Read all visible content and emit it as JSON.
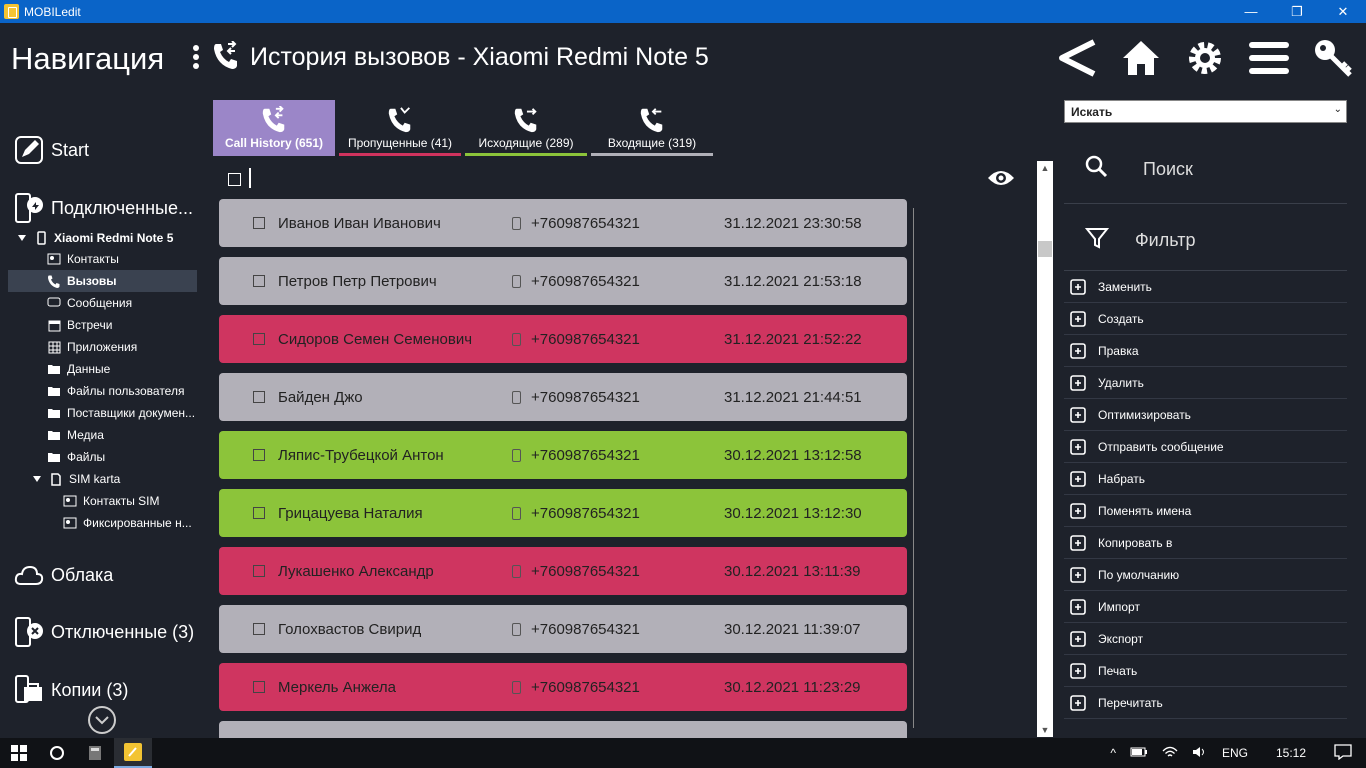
{
  "window": {
    "title": "MOBILedit",
    "min": "—",
    "max": "❐",
    "close": "✕"
  },
  "header": {
    "nav_title": "Навигация",
    "page_title": "История вызовов - Xiaomi Redmi Note 5"
  },
  "sidebar": {
    "start": "Start",
    "connected": "Подключенные...",
    "device": "Xiaomi Redmi Note 5",
    "items": [
      "Контакты",
      "Вызовы",
      "Сообщения",
      "Встречи",
      "Приложения",
      "Данные",
      "Файлы пользователя",
      "Поставщики докумен...",
      "Медиа",
      "Файлы",
      "SIM karta"
    ],
    "sim_items": [
      "Контакты SIM",
      "Фиксированные н..."
    ],
    "clouds": "Облака",
    "disconnected": "Отключенные (3)",
    "copies": "Копии (3)"
  },
  "tabs": [
    {
      "label": "Call History (651)",
      "color": "#9b86c8"
    },
    {
      "label": "Пропущенные (41)",
      "color": "#d0335e"
    },
    {
      "label": "Исходящие (289)",
      "color": "#8cc43a"
    },
    {
      "label": "Входящие (319)",
      "color": "#b0b0b8"
    }
  ],
  "calls": [
    {
      "name": "Иванов Иван Иванович",
      "number": "+760987654321",
      "date": "31.12.2021 23:30:58",
      "color": "#b2b0b8"
    },
    {
      "name": "Петров Петр Петрович",
      "number": "+760987654321",
      "date": "31.12.2021 21:53:18",
      "color": "#b2b0b8"
    },
    {
      "name": "Сидоров Семен Семенович",
      "number": "+760987654321",
      "date": "31.12.2021 21:52:22",
      "color": "#cf3560"
    },
    {
      "name": "Байден Джо",
      "number": "+760987654321",
      "date": "31.12.2021 21:44:51",
      "color": "#b2b0b8"
    },
    {
      "name": "Ляпис-Трубецкой Антон",
      "number": "+760987654321",
      "date": "30.12.2021 13:12:58",
      "color": "#8cc43a"
    },
    {
      "name": "Грицацуева Наталия",
      "number": "+760987654321",
      "date": "30.12.2021 13:12:30",
      "color": "#8cc43a"
    },
    {
      "name": "Лукашенко Александр",
      "number": "+760987654321",
      "date": "30.12.2021 13:11:39",
      "color": "#cf3560"
    },
    {
      "name": "Голохвастов Свирид",
      "number": "+760987654321",
      "date": "30.12.2021 11:39:07",
      "color": "#b2b0b8"
    },
    {
      "name": "Меркель Анжела",
      "number": "+760987654321",
      "date": "30.12.2021 11:23:29",
      "color": "#cf3560"
    },
    {
      "name": "",
      "number": "",
      "date": "",
      "color": "#b2b0b8"
    }
  ],
  "right": {
    "search_select": "Искать",
    "search": "Поиск",
    "filter": "Фильтр",
    "actions": [
      "Заменить",
      "Создать",
      "Правка",
      "Удалить",
      "Оптимизировать",
      "Отправить сообщение",
      "Набрать",
      "Поменять имена",
      "Копировать в",
      "По умолчанию",
      "Импорт",
      "Экспорт",
      "Печать",
      "Перечитать"
    ]
  },
  "taskbar": {
    "lang": "ENG",
    "time": "15:12"
  }
}
